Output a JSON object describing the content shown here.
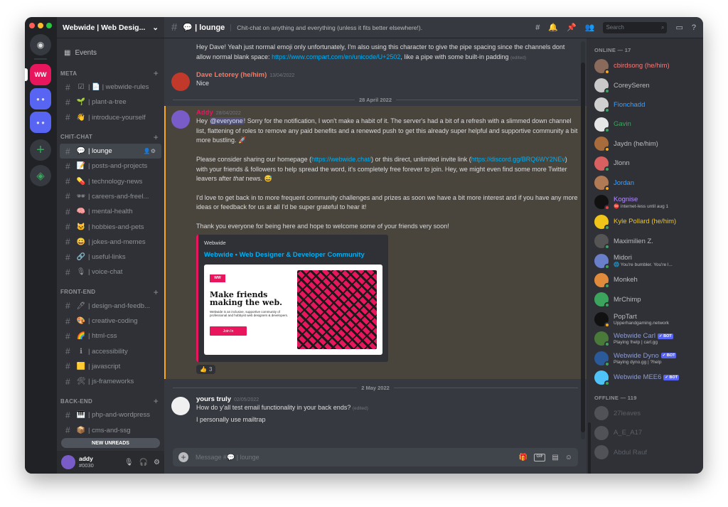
{
  "guild": {
    "name": "Webwide | Web Desig...",
    "caret": "⌄"
  },
  "rail": {
    "ww_label": "WW"
  },
  "sidebar": {
    "events_label": "Events",
    "categories": [
      {
        "name": "META",
        "channels": [
          {
            "emoji": "☑",
            "name": "| 📄 | webwide-rules"
          },
          {
            "emoji": "🌱",
            "name": "| plant-a-tree"
          },
          {
            "emoji": "👋",
            "name": "| introduce-yourself"
          }
        ]
      },
      {
        "name": "CHIT-CHAT",
        "channels": [
          {
            "emoji": "💬",
            "name": "| lounge",
            "active": true
          },
          {
            "emoji": "📝",
            "name": "| posts-and-projects"
          },
          {
            "emoji": "💊",
            "name": "| technology-news"
          },
          {
            "emoji": "🕶",
            "name": "| careers-and-freel..."
          },
          {
            "emoji": "🧠",
            "name": "| mental-health"
          },
          {
            "emoji": "🐱",
            "name": "| hobbies-and-pets"
          },
          {
            "emoji": "😀",
            "name": "| jokes-and-memes"
          },
          {
            "emoji": "🔗",
            "name": "| useful-links"
          },
          {
            "emoji": "🎙",
            "name": "| voice-chat"
          }
        ]
      },
      {
        "name": "FRONT-END",
        "channels": [
          {
            "emoji": "🖊",
            "name": "| design-and-feedb..."
          },
          {
            "emoji": "🎨",
            "name": "| creative-coding"
          },
          {
            "emoji": "🌈",
            "name": "| html-css"
          },
          {
            "emoji": "ℹ",
            "name": "| accessibility"
          },
          {
            "emoji": "🟨",
            "name": "| javascript"
          },
          {
            "emoji": "🛠",
            "name": "| js-frameworks"
          }
        ]
      },
      {
        "name": "BACK-END",
        "channels": [
          {
            "emoji": "🎹",
            "name": "| php-and-wordpress"
          },
          {
            "emoji": "📦",
            "name": "| cms-and-ssg"
          }
        ]
      }
    ],
    "new_unreads": "NEW UNREADS",
    "user": {
      "name": "addy",
      "disc": "#0030"
    }
  },
  "topbar": {
    "channel": "💬 | lounge",
    "topic": "Chit-chat on anything and everything (unless it fits better elsewhere!).",
    "search_placeholder": "Search"
  },
  "messages": {
    "m1": {
      "text_a": "Hey Dave! Yeah just normal emoji only unfortunately, I'm also using this character to give the pipe spacing since the channels dont allow normal blank space: ",
      "link": "https://www.compart.com/en/unicode/U+2502",
      "text_b": ", like a pipe with some built-in padding ",
      "edited": "(edited)"
    },
    "m2": {
      "author": "Dave Letorey (he/him)",
      "ts": "13/04/2022",
      "text": "Nice"
    },
    "date1": "28 April 2022",
    "m3": {
      "author": "Addy",
      "ts": "28/04/2022",
      "p1_a": "Hey ",
      "mention": "@everyone",
      "p1_b": "! Sorry for the notification, I won't make a habit of it. The server's had a bit of a refresh with a slimmed down channel list, flattening of roles to remove any paid benefits and a renewed push to get this already super helpful and supportive community a bit more bustling. 🚀",
      "p2_a": "Please consider sharing our homepage (",
      "p2_link1": "https://webwide.chat/",
      "p2_b": ") or this direct, unlimited invite link (",
      "p2_link2": "https://discord.gg/BRQ6WY2NEv",
      "p2_c": ") with your friends & followers to help spread the word, it's completely free forever to join. Hey, we might even find some more Twitter leavers after ",
      "p2_em": "that",
      "p2_d": " news. 😅",
      "p3": "I'd love to get back in to more frequent community challenges and prizes as soon we have a bit more interest and if you have any more ideas or feedback for us at all I'd be super grateful to hear it!",
      "p4": "Thank you everyone for being here and hope to welcome some of your friends very soon!",
      "embed": {
        "provider": "Webwide",
        "title": "Webwide • Web Designer & Developer Community",
        "img_logo": "WW",
        "img_title": "Make friends making the web.",
        "img_sub": "Webwide is an inclusive, supportive community of professional and hobbyist web designers & developers.",
        "img_btn": "Join In"
      },
      "reaction": {
        "emoji": "👍",
        "count": "3"
      }
    },
    "date2": "2 May 2022",
    "m4": {
      "author": "yours truly",
      "ts": "02/05/2022",
      "line1": "How do y'all test email functionality in your back ends? ",
      "edited": "(edited)",
      "line2": "I personally use mailtrap"
    }
  },
  "composer": {
    "placeholder": "Message #💬 | lounge",
    "gif": "GIF"
  },
  "members": {
    "online_header": "ONLINE — 17",
    "online": [
      {
        "name": "cbirdsong (he/him)",
        "color": "#f47b7b",
        "av": "#8a6a5a",
        "status": "#faa61a"
      },
      {
        "name": "CoreySeren",
        "color": "#b9bbbe",
        "av": "#c9c9c9",
        "status": "#3ba55d"
      },
      {
        "name": "Fionchadd",
        "color": "#3ca0ff",
        "av": "#d0d0d0",
        "status": "#3ba55d"
      },
      {
        "name": "Gavin",
        "color": "#3ba55d",
        "av": "#e6e6e6",
        "status": "#3ba55d"
      },
      {
        "name": "Jaydn (he/him)",
        "color": "#b9bbbe",
        "av": "#a86b3c",
        "status": "#faa61a"
      },
      {
        "name": "Jlonn",
        "color": "#b9bbbe",
        "av": "#d96060",
        "status": "#3ba55d"
      },
      {
        "name": "Jordan",
        "color": "#3ca0ff",
        "av": "#b07a55",
        "status": "#faa61a"
      },
      {
        "name": "Kognise",
        "color": "#b38cff",
        "av": "#111111",
        "status": "#ed4245",
        "sub": "⛔ internet-less until aug 1"
      },
      {
        "name": "Kyle Pollard (he/him)",
        "color": "#f0c419",
        "av": "#f0c419",
        "status": "#3ba55d"
      },
      {
        "name": "Maximilien Z.",
        "color": "#b9bbbe",
        "av": "#555555",
        "status": "#3ba55d"
      },
      {
        "name": "Midori",
        "color": "#b9bbbe",
        "av": "#6a7fc9",
        "status": "#3ba55d",
        "sub": "🌐 You're bumbler. You're l..."
      },
      {
        "name": "Monkeh",
        "color": "#b9bbbe",
        "av": "#e08a3c",
        "status": "#3ba55d"
      },
      {
        "name": "MrChimp",
        "color": "#b9bbbe",
        "av": "#3ba55d",
        "status": "#3ba55d"
      },
      {
        "name": "PopTart",
        "color": "#b9bbbe",
        "av": "#111111",
        "status": "#faa61a",
        "sub": "Upperhandgaming.network"
      },
      {
        "name": "Webwide Carl",
        "color": "#8e9ccf",
        "av": "#4a7a3a",
        "status": "#3ba55d",
        "bot": "✓ BOT",
        "sub": "Playing !help | carl.gg"
      },
      {
        "name": "Webwide Dyno",
        "color": "#8e9ccf",
        "av": "#2a5a9a",
        "status": "#3ba55d",
        "bot": "✓ BOT",
        "sub": "Playing dyno.gg | ?help"
      },
      {
        "name": "Webwide MEE6",
        "color": "#8e9ccf",
        "av": "#4fc3f7",
        "status": "#3ba55d",
        "bot": "✓ BOT"
      }
    ],
    "offline_header": "OFFLINE — 119",
    "offline": [
      {
        "name": "27leaves"
      },
      {
        "name": "A_E_A17"
      },
      {
        "name": "Abdul Rauf"
      }
    ]
  },
  "colors": {
    "accent": "#e8175d",
    "blurple": "#5865f2",
    "link": "#00aff4"
  }
}
